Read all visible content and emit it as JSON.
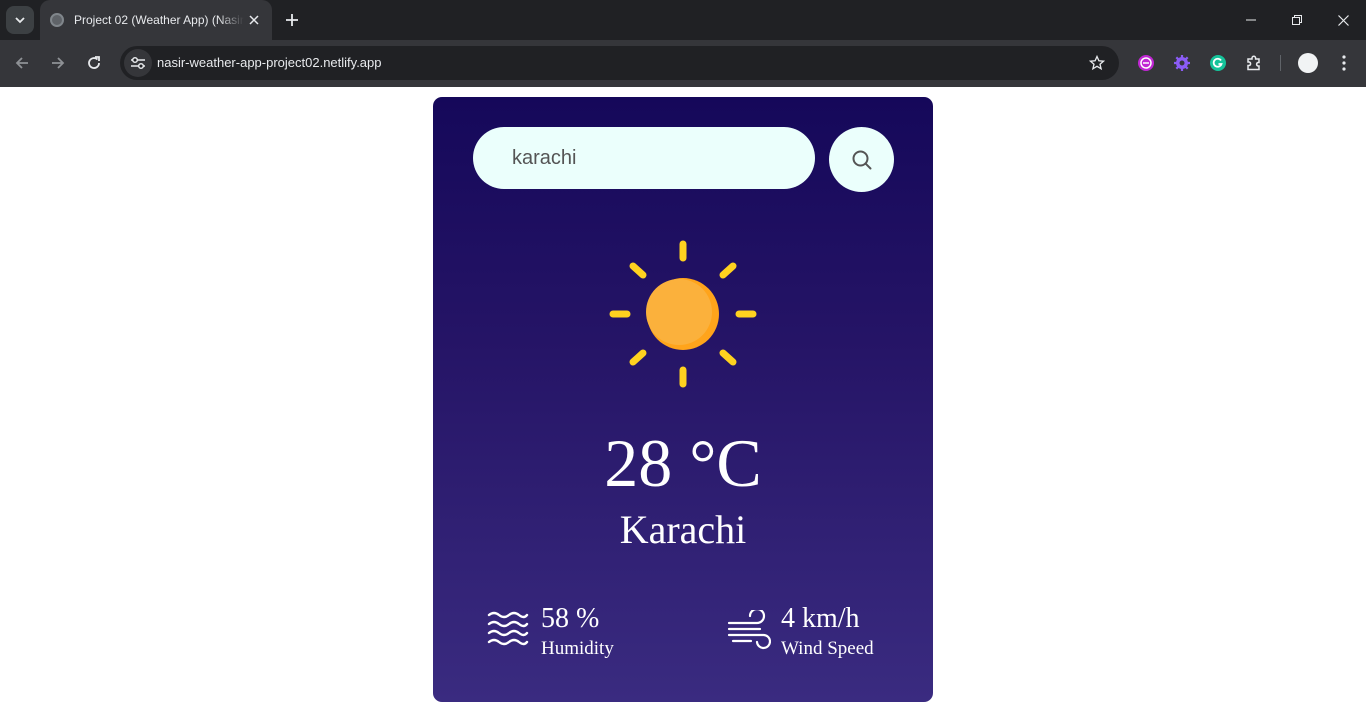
{
  "browser": {
    "tab_title": "Project 02 (Weather App) (Nasir",
    "url": "nasir-weather-app-project02.netlify.app"
  },
  "weather": {
    "search_value": "karachi",
    "condition_icon": "sun-icon",
    "temperature": "28 °C",
    "city": "Karachi",
    "humidity_value": "58 %",
    "humidity_label": "Humidity",
    "wind_value": "4 km/h",
    "wind_label": "Wind Speed"
  },
  "colors": {
    "card_top": "#15085a",
    "card_bottom": "#3a2b80",
    "input_bg": "#ebfffc",
    "sun": "#fbb13c",
    "sun_rays": "#ffd21f"
  }
}
